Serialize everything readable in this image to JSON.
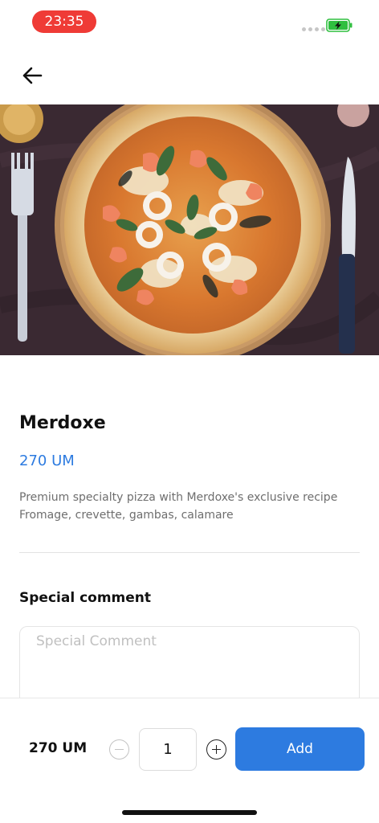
{
  "status_bar": {
    "time": "23:35"
  },
  "product": {
    "name": "Merdoxe",
    "price": "270 UM",
    "description_lines": [
      "Premium specialty pizza with Merdoxe's exclusive recipe",
      "Fromage, crevette, gambas, calamare"
    ]
  },
  "comment": {
    "title": "Special comment",
    "placeholder": "Special Comment",
    "value": ""
  },
  "order": {
    "total": "270 UM",
    "quantity": "1",
    "add_label": "Add"
  },
  "colors": {
    "accent": "#2d7be0",
    "time_pill": "#ef3b36",
    "battery": "#2fbf3f"
  },
  "icons": [
    "back-arrow-icon",
    "battery-charging-icon",
    "minus-icon",
    "plus-icon"
  ]
}
